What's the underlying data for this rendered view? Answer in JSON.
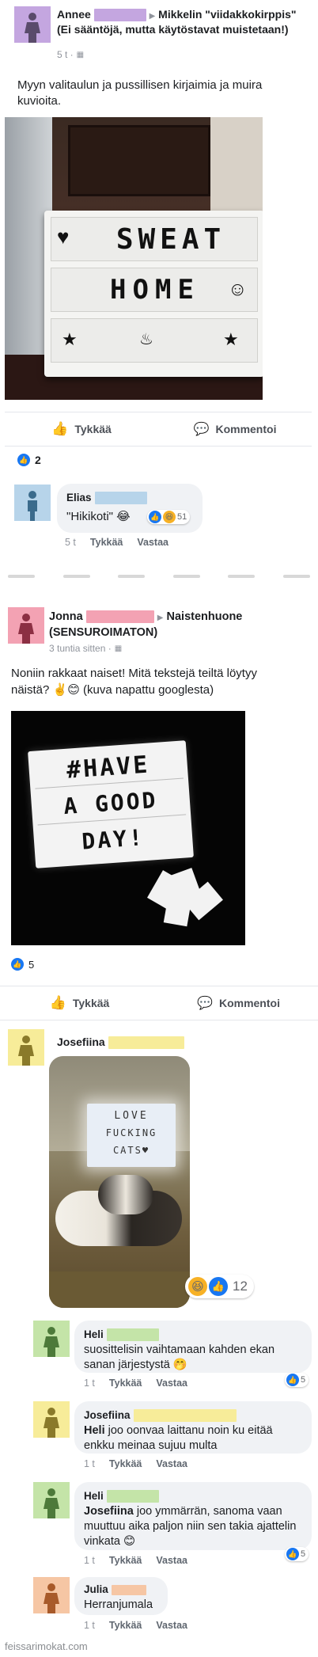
{
  "colors": {
    "purple_avatar": "#c4a6e0",
    "blue_avatar": "#b7d4ea",
    "pink_avatar": "#f3a2b3",
    "yellow_avatar": "#f7ec99",
    "green_avatar": "#c4e4a8",
    "peach_avatar": "#f6c6a4",
    "fb_blue": "#1877f2"
  },
  "post1": {
    "author": "Annee",
    "group": "Mikkelin \"viidakkokirppis\" (Ei sääntöjä, mutta käytöstavat muistetaan!)",
    "time": "5 t ·",
    "text": "Myyn valitaulun ja pussillisen kirjaimia ja muira kuvioita.",
    "lightbox_line1": "SWEAT",
    "lightbox_line2": "HOME",
    "like_label": "Tykkää",
    "comment_label": "Kommentoi",
    "reaction_count": "2",
    "comment": {
      "author": "Elias",
      "text": "\"Hikikoti\" 😂",
      "reaction_count": "51",
      "time": "5 t",
      "like": "Tykkää",
      "reply": "Vastaa"
    }
  },
  "post2": {
    "author": "Jonna",
    "group": "Naistenhuone (SENSUROIMATON)",
    "time": "3 tuntia sitten ·",
    "text": "Noniin rakkaat naiset! Mitä tekstejä teiltä löytyy näistä? ✌️😊 (kuva napattu googlesta)",
    "lightbox_line1": "#HAVE",
    "lightbox_line2": "A GOOD",
    "lightbox_line3": "DAY!",
    "reaction_count": "5",
    "like_label": "Tykkää",
    "comment_label": "Kommentoi"
  },
  "thread": {
    "josefiina_name": "Josefiina",
    "photo_line1": "LOVE",
    "photo_line2": "FUCKING",
    "photo_line3": "CATS♥",
    "photo_reactions": "12",
    "comments": [
      {
        "author": "Heli",
        "text": "suosittelisin vaihtamaan kahden ekan sanan järjestystä 🤭",
        "time": "1 t",
        "like": "Tykkää",
        "reply": "Vastaa",
        "reactions": "5"
      },
      {
        "author": "Josefiina",
        "mention": "Heli",
        "text": " joo oonvaa laittanu noin ku eitää enkku meinaa sujuu multa",
        "time": "1 t",
        "like": "Tykkää",
        "reply": "Vastaa"
      },
      {
        "author": "Heli",
        "mention": "Josefiina",
        "text": " joo ymmärrän, sanoma vaan muuttuu aika paljon niin sen takia ajattelin vinkata 😊",
        "time": "1 t",
        "like": "Tykkää",
        "reply": "Vastaa",
        "reactions": "5"
      },
      {
        "author": "Julia",
        "text": "Herranjumala",
        "time": "1 t",
        "like": "Tykkää",
        "reply": "Vastaa"
      }
    ]
  },
  "watermark": "feissarimokat.com"
}
